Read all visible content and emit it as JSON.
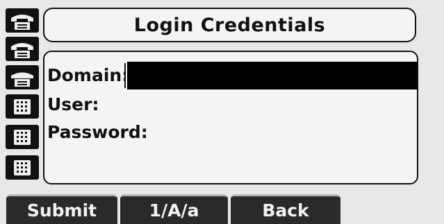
{
  "title": "Login Credentials",
  "fields": [
    {
      "label": "Domain:",
      "value": ""
    },
    {
      "label": "User:",
      "value": ""
    },
    {
      "label": "Password:",
      "value": ""
    }
  ],
  "line_keys": [
    {
      "icon": "handset-icon"
    },
    {
      "icon": "handset-icon"
    },
    {
      "icon": "handset-icon"
    },
    {
      "icon": "keypad-icon"
    },
    {
      "icon": "keypad-icon"
    },
    {
      "icon": "keypad-icon"
    }
  ],
  "softkeys": {
    "submit": "Submit",
    "input_mode": "1/A/a",
    "back": "Back"
  },
  "colors": {
    "background": "#e8e8e8",
    "panel": "#f4f4f4",
    "ink": "#111111",
    "softkey": "#2a2a2a"
  }
}
